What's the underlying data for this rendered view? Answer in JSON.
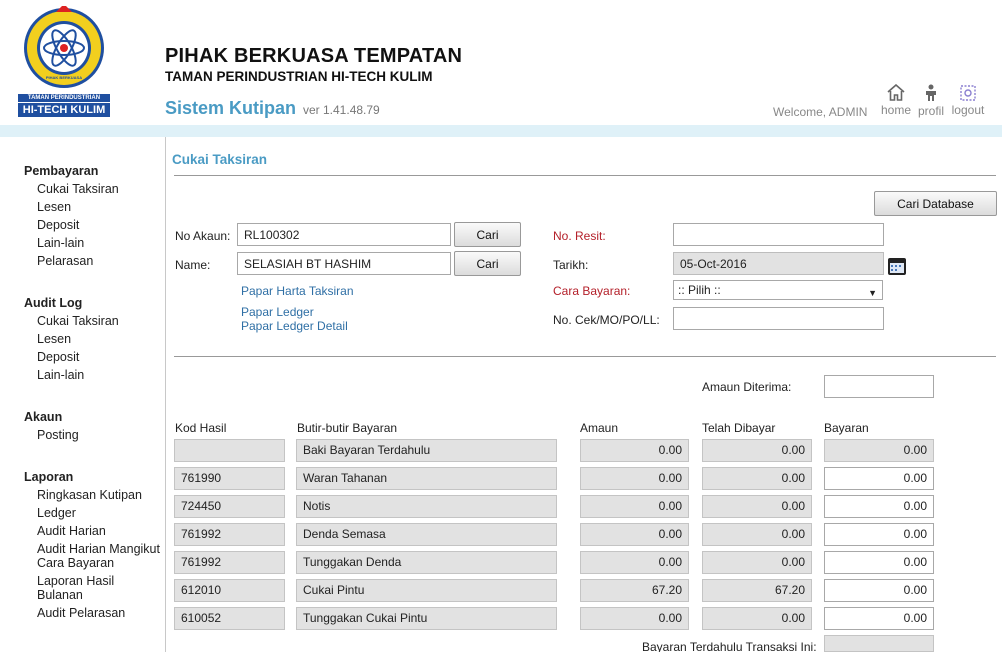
{
  "header": {
    "org_title": "PIHAK BERKUASA TEMPATAN",
    "org_subtitle": "TAMAN PERINDUSTRIAN HI-TECH KULIM",
    "system_title": "Sistem Kutipan",
    "version": "ver 1.41.48.79",
    "welcome": "Welcome, ADMIN",
    "logo_top_text": "PIHAK BERKUASA TEMPATAN",
    "logo_line1": "TAMAN PERINDUSTRIAN",
    "logo_line2": "HI-TECH KULIM",
    "nav": {
      "home": "home",
      "profil": "profil",
      "logout": "logout"
    }
  },
  "sidebar": {
    "groups": [
      {
        "title": "Pembayaran",
        "items": [
          "Cukai Taksiran",
          "Lesen",
          "Deposit",
          "Lain-lain",
          "Pelarasan"
        ]
      },
      {
        "title": "Audit Log",
        "items": [
          "Cukai Taksiran",
          "Lesen",
          "Deposit",
          "Lain-lain"
        ]
      },
      {
        "title": "Akaun",
        "items": [
          "Posting"
        ]
      },
      {
        "title": "Laporan",
        "items": [
          "Ringkasan Kutipan",
          "Ledger",
          "Audit Harian",
          "Audit Harian Mangikut Cara Bayaran",
          "Laporan Hasil Bulanan",
          "Audit Pelarasan"
        ]
      }
    ]
  },
  "form": {
    "page_title": "Cukai Taksiran",
    "cari_database": "Cari Database",
    "no_akaun_label": "No Akaun:",
    "no_akaun_value": "RL100302",
    "name_label": "Name:",
    "name_value": "SELASIAH BT HASHIM",
    "cari_label": "Cari",
    "link_harta": "Papar Harta Taksiran",
    "link_ledger": "Papar Ledger",
    "link_ledger_detail": "Papar Ledger Detail",
    "no_resit_label": "No. Resit:",
    "no_resit_value": "",
    "tarikh_label": "Tarikh:",
    "tarikh_value": "05-Oct-2016",
    "cara_bayaran_label": "Cara Bayaran:",
    "cara_bayaran_value": ":: Pilih ::",
    "no_cek_label": "No. Cek/MO/PO/LL:",
    "no_cek_value": "",
    "amaun_diterima_label": "Amaun Diterima:",
    "amaun_diterima_value": ""
  },
  "table": {
    "headers": [
      "Kod Hasil",
      "Butir-butir Bayaran",
      "Amaun",
      "Telah Dibayar",
      "Bayaran"
    ],
    "rows": [
      {
        "kod": "",
        "butir": "Baki Bayaran Terdahulu",
        "amaun": "0.00",
        "dibayar": "0.00",
        "bayaran": "0.00"
      },
      {
        "kod": "761990",
        "butir": "Waran Tahanan",
        "amaun": "0.00",
        "dibayar": "0.00",
        "bayaran": "0.00"
      },
      {
        "kod": "724450",
        "butir": "Notis",
        "amaun": "0.00",
        "dibayar": "0.00",
        "bayaran": "0.00"
      },
      {
        "kod": "761992",
        "butir": "Denda Semasa",
        "amaun": "0.00",
        "dibayar": "0.00",
        "bayaran": "0.00"
      },
      {
        "kod": "761992",
        "butir": "Tunggakan Denda",
        "amaun": "0.00",
        "dibayar": "0.00",
        "bayaran": "0.00"
      },
      {
        "kod": "612010",
        "butir": "Cukai Pintu",
        "amaun": "67.20",
        "dibayar": "67.20",
        "bayaran": "0.00"
      },
      {
        "kod": "610052",
        "butir": "Tunggakan Cukai Pintu",
        "amaun": "0.00",
        "dibayar": "0.00",
        "bayaran": "0.00"
      }
    ],
    "footer_label": "Bayaran Terdahulu Transaksi Ini:"
  },
  "colors": {
    "accent": "#4a9bc4",
    "band": "#dff1f8",
    "required": "#b4202a",
    "link": "#2f6fa5"
  }
}
